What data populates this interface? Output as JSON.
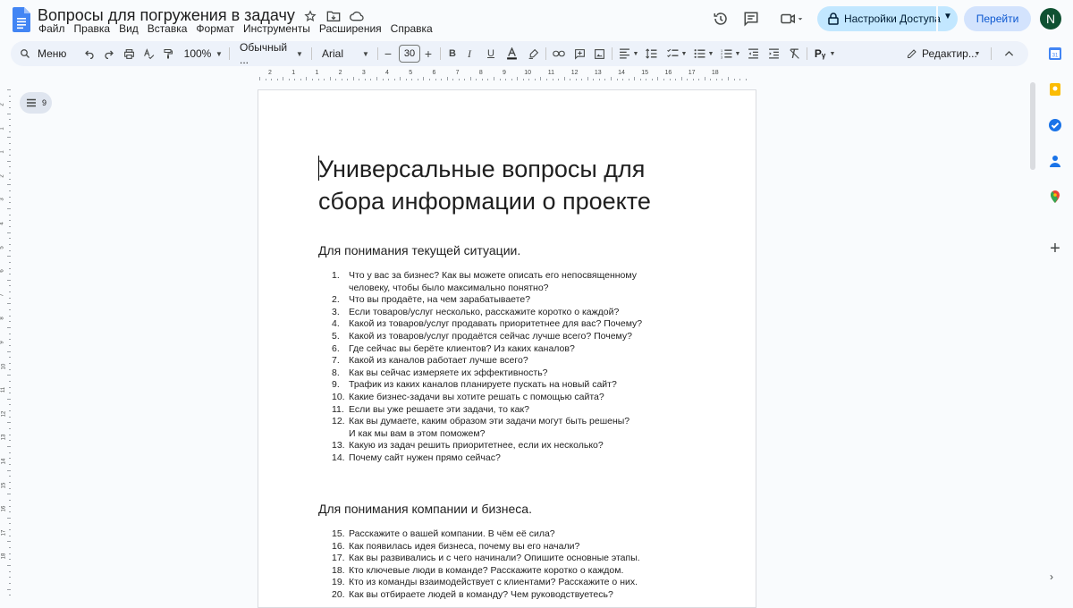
{
  "doc": {
    "title": "Вопросы для погружения в задачу",
    "menu": [
      "Файл",
      "Правка",
      "Вид",
      "Вставка",
      "Формат",
      "Инструменты",
      "Расширения",
      "Справка"
    ]
  },
  "header": {
    "share_label": "Настройки Доступа",
    "go_label": "Перейти",
    "avatar_letter": "N"
  },
  "toolbar": {
    "menu_label": "Меню",
    "zoom": "100%",
    "style": "Обычный ...",
    "font": "Arial",
    "font_size": "30",
    "mode": "Редактир..."
  },
  "ruler": {
    "labels": [
      "2",
      "1",
      "1",
      "2",
      "3",
      "4",
      "5",
      "6",
      "7",
      "8",
      "9",
      "10",
      "11",
      "12",
      "13",
      "14",
      "15",
      "16",
      "17",
      "18"
    ]
  },
  "vruler": {
    "labels": [
      "2",
      "1",
      "1",
      "2",
      "3",
      "4",
      "5",
      "6",
      "7",
      "8",
      "9",
      "10",
      "11",
      "12",
      "13",
      "14",
      "15",
      "16",
      "17",
      "18"
    ]
  },
  "outline": {
    "count": "9"
  },
  "content": {
    "heading": "Универсальные вопросы для сбора информации о проекте",
    "section1": "Для понимания текущей ситуации.",
    "list1": [
      {
        "n": "1.",
        "t": "Что у вас за бизнес? Как вы можете описать его непосвященному"
      },
      {
        "n": "",
        "t": "человеку, чтобы было максимально понятно?"
      },
      {
        "n": "2.",
        "t": "Что вы продаёте, на чем зарабатываете?"
      },
      {
        "n": "3.",
        "t": "Если товаров/услуг несколько, расскажите коротко о каждой?"
      },
      {
        "n": "4.",
        "t": "Какой из товаров/услуг продавать приоритетнее для вас? Почему?"
      },
      {
        "n": "5.",
        "t": "Какой из товаров/услуг продаётся сейчас лучше всего? Почему?"
      },
      {
        "n": "6.",
        "t": "Где сейчас вы берёте клиентов? Из каких каналов?"
      },
      {
        "n": "7.",
        "t": "Какой из каналов работает лучше всего?"
      },
      {
        "n": "8.",
        "t": "Как вы сейчас измеряете их эффективность?"
      },
      {
        "n": "9.",
        "t": "Трафик из каких каналов планируете пускать на новый сайт?"
      },
      {
        "n": "10.",
        "t": "Какие бизнес-задачи вы хотите решать с помощью сайта?"
      },
      {
        "n": "11.",
        "t": "Если вы уже решаете эти задачи, то как?"
      },
      {
        "n": "12.",
        "t": "Как вы думаете, каким образом эти задачи могут быть решены?"
      },
      {
        "n": "",
        "t": "И как мы вам в этом поможем?"
      },
      {
        "n": "13.",
        "t": "Какую из задач решить приоритетнее, если их несколько?"
      },
      {
        "n": "14.",
        "t": "Почему сайт нужен прямо сейчас?"
      }
    ],
    "section2": "Для понимания компании и бизнеса.",
    "list2": [
      {
        "n": "15.",
        "t": "Расскажите о вашей компании. В чём её сила?"
      },
      {
        "n": "16.",
        "t": "Как появилась идея бизнеса, почему вы его начали?"
      },
      {
        "n": "17.",
        "t": "Как вы развивались и с чего начинали? Опишите основные этапы."
      },
      {
        "n": "18.",
        "t": "Кто ключевые люди в команде? Расскажите коротко о каждом."
      },
      {
        "n": "19.",
        "t": "Кто из команды взаимодействует с клиентами? Расскажите о них."
      },
      {
        "n": "20.",
        "t": "Как вы отбираете людей в команду? Чем руководствуетесь?"
      }
    ]
  },
  "colors": {
    "share_bg": "#c2e7ff",
    "go_bg": "#d3e3fd",
    "toolbar_bg": "#edf2fa",
    "avatar_bg": "#0f5132",
    "docs_blue": "#4285f4"
  }
}
